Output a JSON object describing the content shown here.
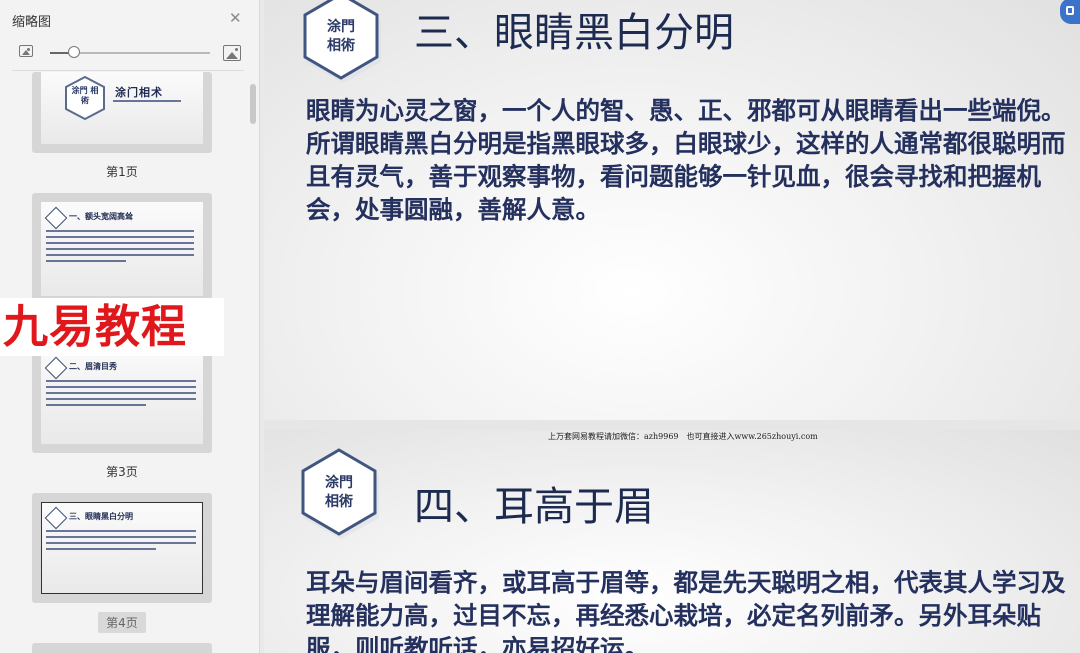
{
  "sidebar": {
    "title": "缩略图",
    "close_icon": "close-icon",
    "zoom_out_icon": "image-small-icon",
    "zoom_in_icon": "image-large-icon",
    "zoom_level": 0.15,
    "thumbnails": [
      {
        "page_label": "第1页",
        "logo": "涂門 相術",
        "heading": "涂门相术"
      },
      {
        "page_label": "",
        "heading": "一、额头宽阔高耸"
      },
      {
        "page_label": "第3页",
        "heading": "二、眉清目秀"
      },
      {
        "page_label": "第4页",
        "heading": "三、眼睛黑白分明",
        "selected": true
      }
    ],
    "watermark": "九易教程"
  },
  "slides": [
    {
      "logo_line1": "涂門",
      "logo_line2": "相術",
      "title": "三、眼睛黑白分明",
      "body": "眼睛为心灵之窗，一个人的智、愚、正、邪都可从眼睛看出一些端倪。所谓眼睛黑白分明是指黑眼球多，白眼球少，这样的人通常都很聪明而且有灵气，善于观察事物，看问题能够一针见血，很会寻找和把握机会，处事圆融，善解人意。"
    },
    {
      "footer_note": "上万套网易教程请加微信：azh9969　也可直接进入www.265zhouyi.com",
      "logo_line1": "涂門",
      "logo_line2": "相術",
      "title": "四、耳高于眉",
      "body": "耳朵与眉间看齐，或耳高于眉等，都是先天聪明之相，代表其人学习及理解能力高，过目不忘，再经悉心栽培，必定名列前矛。另外耳朵贴服，则听教听话，亦易招好运。"
    }
  ],
  "colors": {
    "title": "#1d2b50",
    "body": "#24305e",
    "watermark": "#e0171b",
    "accent": "#3a73c8"
  }
}
